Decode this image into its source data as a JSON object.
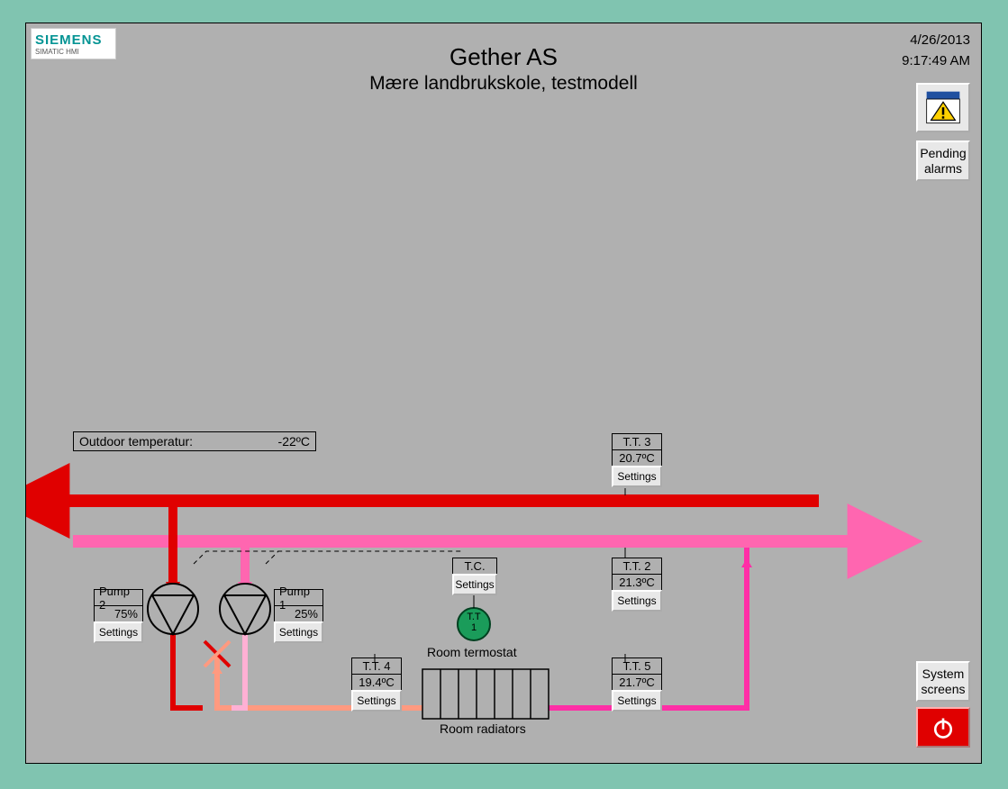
{
  "logo": {
    "brand": "SIEMENS",
    "sub": "SIMATIC HMI"
  },
  "header": {
    "title": "Gether AS",
    "subtitle": "Mære landbrukskole, testmodell",
    "date": "4/26/2013",
    "time": "9:17:49 AM"
  },
  "buttons": {
    "pending_alarms": "Pending alarms",
    "system_screens": "System screens",
    "settings": "Settings"
  },
  "outdoor": {
    "label": "Outdoor temperatur:",
    "value": "-22ºC"
  },
  "labels": {
    "room_termostat": "Room termostat",
    "room_radiators": "Room radiators",
    "tt1_a": "T.T",
    "tt1_b": "1"
  },
  "pump2": {
    "name": "Pump 2",
    "value": "75%"
  },
  "pump1": {
    "name": "Pump 1",
    "value": "25%"
  },
  "tc": {
    "name": "T.C."
  },
  "tt3": {
    "name": "T.T. 3",
    "value": "20.7ºC"
  },
  "tt2": {
    "name": "T.T. 2",
    "value": "21.3ºC"
  },
  "tt5": {
    "name": "T.T. 5",
    "value": "21.7ºC"
  },
  "tt4": {
    "name": "T.T. 4",
    "value": "19.4ºC"
  },
  "colors": {
    "hot": "#e00000",
    "cool": "#ff66b0",
    "cool_lt": "#ffb0d4",
    "hot_lt": "#ff9a80",
    "thermostat": "#1a9c5a",
    "outer_bg": "#80c4b0",
    "panel_bg": "#b0b0b0"
  }
}
